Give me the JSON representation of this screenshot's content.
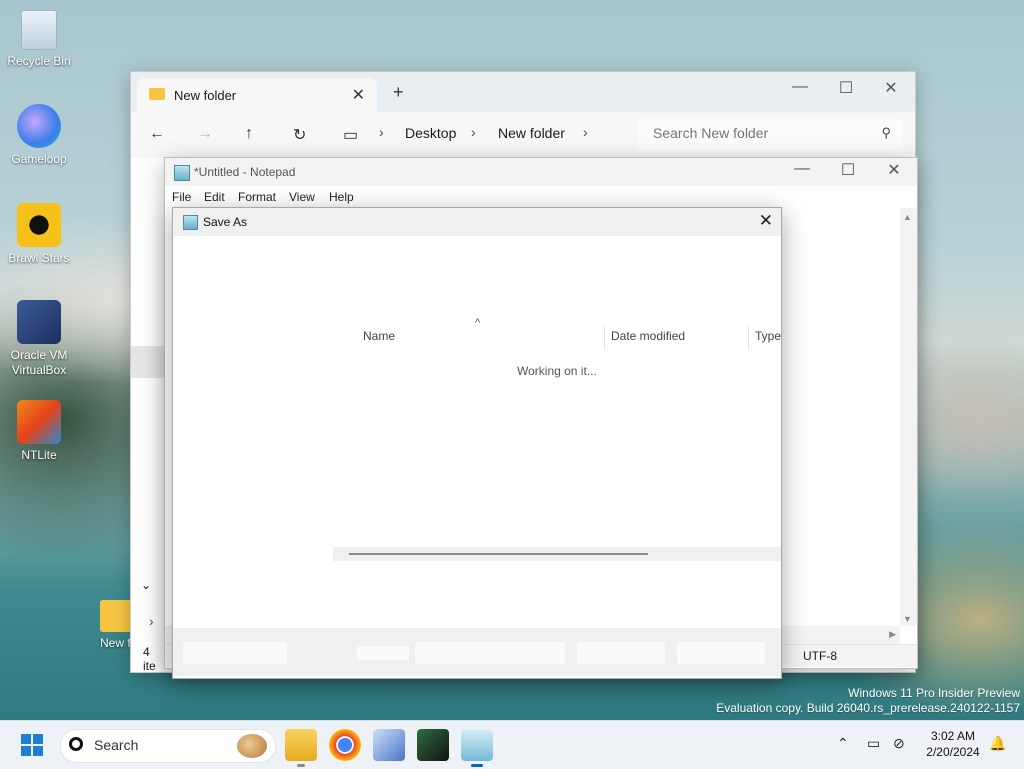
{
  "desktop": {
    "icons": [
      {
        "label": "Recycle Bin"
      },
      {
        "label": "Gameloop"
      },
      {
        "label": "Brawl Stars"
      },
      {
        "label": "Oracle VM VirtualBox"
      },
      {
        "label": "NTLite"
      }
    ],
    "folder_label": "New fol",
    "watermark_line1": "Windows 11 Pro Insider Preview",
    "watermark_line2": "Evaluation copy. Build 26040.rs_prerelease.240122-1157"
  },
  "explorer": {
    "tab_title": "New folder",
    "breadcrumb": [
      "Desktop",
      "New folder"
    ],
    "search_placeholder": "Search New folder",
    "item_count": "4 ite"
  },
  "notepad": {
    "title": "*Untitled - Notepad",
    "menu": [
      "File",
      "Edit",
      "Format",
      "View",
      "Help"
    ],
    "encoding": "UTF-8"
  },
  "save_as": {
    "title": "Save As",
    "columns": [
      "Name",
      "Date modified",
      "Type"
    ],
    "status": "Working on it..."
  },
  "taskbar": {
    "search_label": "Search",
    "time": "3:02 AM",
    "date": "2/20/2024"
  },
  "colors": {
    "accent": "#0067c0",
    "folder": "#f5c542"
  }
}
